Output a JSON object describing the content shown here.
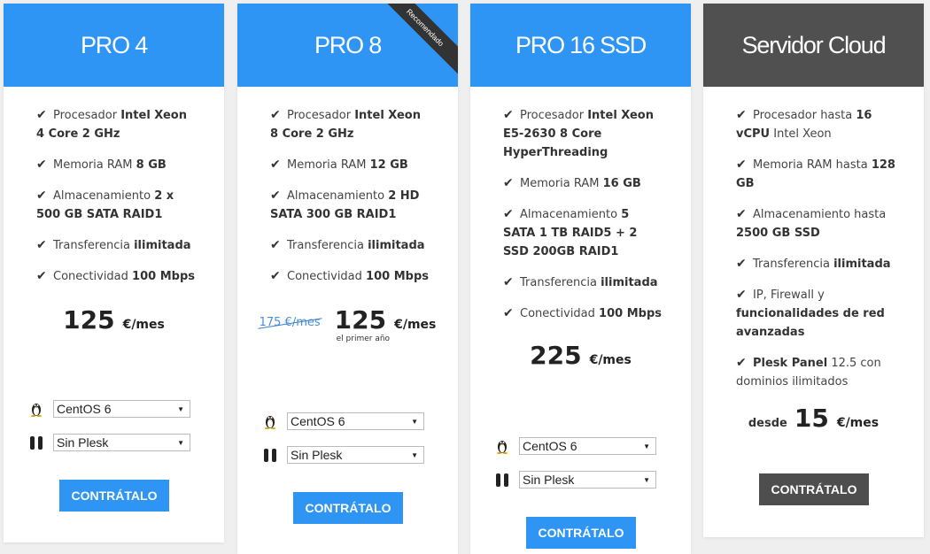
{
  "plans": [
    {
      "title": "PRO 4",
      "features": [
        {
          "pre": "Procesador ",
          "bold": "Intel Xeon 4 Core 2 GHz",
          "post": ""
        },
        {
          "pre": "Memoria RAM ",
          "bold": "8 GB",
          "post": ""
        },
        {
          "pre": "Almacenamiento ",
          "bold": "2 x 500 GB SATA RAID1",
          "post": ""
        },
        {
          "pre": "Transferencia ",
          "bold": "ilimitada",
          "post": ""
        },
        {
          "pre": "Conectividad ",
          "bold": "100 Mbps",
          "post": ""
        }
      ],
      "price": "125",
      "unit": "€/mes",
      "os_select": "CentOS 6",
      "panel_select": "Sin Plesk",
      "button": "CONTRÁTALO"
    },
    {
      "title": "PRO 8",
      "ribbon": "Recomendado",
      "features": [
        {
          "pre": "Procesador ",
          "bold": "Intel Xeon 8 Core 2 GHz",
          "post": ""
        },
        {
          "pre": "Memoria RAM ",
          "bold": "12 GB",
          "post": ""
        },
        {
          "pre": "Almacenamiento ",
          "bold": "2 HD SATA 300 GB RAID1",
          "post": ""
        },
        {
          "pre": "Transferencia ",
          "bold": "ilimitada",
          "post": ""
        },
        {
          "pre": "Conectividad ",
          "bold": "100 Mbps",
          "post": ""
        }
      ],
      "old_price": "175 €/mes",
      "price": "125",
      "unit": "€/mes",
      "price_note": "el primer año",
      "os_select": "CentOS 6",
      "panel_select": "Sin Plesk",
      "button": "CONTRÁTALO"
    },
    {
      "title": "PRO 16 SSD",
      "features": [
        {
          "pre": "Procesador ",
          "bold": "Intel Xeon E5-2630 8 Core HyperThreading",
          "post": ""
        },
        {
          "pre": "Memoria RAM ",
          "bold": "16 GB",
          "post": ""
        },
        {
          "pre": "Almacenamiento ",
          "bold": "5 SATA 1 TB RAID5 + 2 SSD 200GB RAID1",
          "post": ""
        },
        {
          "pre": "Transferencia ",
          "bold": "ilimitada",
          "post": ""
        },
        {
          "pre": "Conectividad ",
          "bold": "100 Mbps",
          "post": ""
        }
      ],
      "price": "225",
      "unit": "€/mes",
      "os_select": "CentOS 6",
      "panel_select": "Sin Plesk",
      "button": "CONTRÁTALO"
    },
    {
      "title": "Servidor Cloud",
      "features": [
        {
          "pre": "Procesador hasta ",
          "bold": "16 vCPU",
          "post": " Intel Xeon"
        },
        {
          "pre": "Memoria RAM hasta ",
          "bold": "128 GB",
          "post": ""
        },
        {
          "pre": "Almacenamiento hasta ",
          "bold": "2500 GB SSD",
          "post": ""
        },
        {
          "pre": "Transferencia ",
          "bold": "ilimitada",
          "post": ""
        },
        {
          "pre": "IP, Firewall y ",
          "bold": "funcionalidades de red avanzadas",
          "post": ""
        },
        {
          "pre": "",
          "bold": "Plesk Panel",
          "post": " 12.5 con dominios ilimitados"
        }
      ],
      "price_prefix": "desde",
      "price": "15",
      "unit": "€/mes",
      "button": "CONTRÁTALO"
    }
  ],
  "colors": {
    "accent": "#2f95f5",
    "dark": "#505050",
    "background": "#efefef"
  },
  "icons": {
    "feature": "check-icon",
    "os": "linux-tux-icon",
    "panel": "pause-bars-icon"
  }
}
